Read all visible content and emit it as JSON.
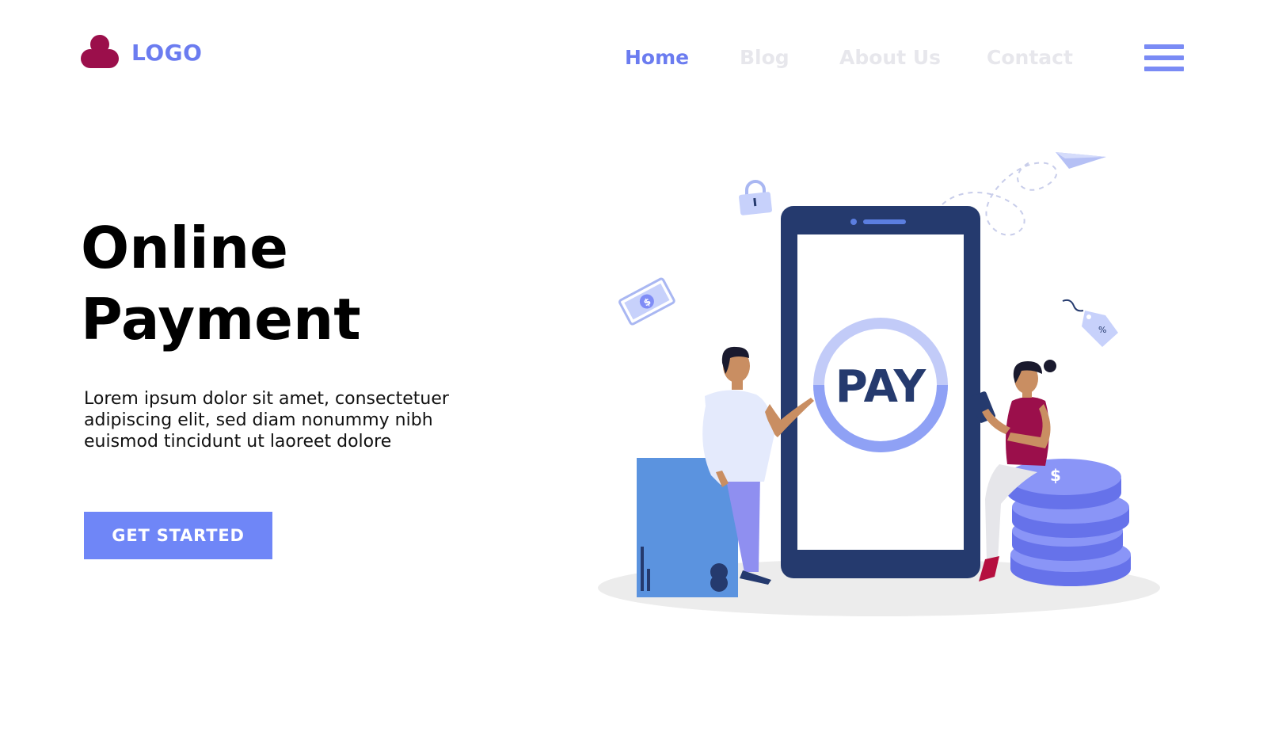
{
  "header": {
    "logo_text": "LOGO",
    "nav": [
      {
        "label": "Home",
        "active": true
      },
      {
        "label": "Blog",
        "active": false
      },
      {
        "label": "About Us",
        "active": false
      },
      {
        "label": "Contact",
        "active": false
      }
    ],
    "menu_icon": "hamburger-menu-icon"
  },
  "hero": {
    "title_line1": "Online",
    "title_line2": "Payment",
    "body": "Lorem ipsum dolor sit amet, consectetuer adipiscing elit, sed diam nonummy nibh euismod tincidunt ut laoreet dolore",
    "cta_label": "GET STARTED"
  },
  "illustration": {
    "pay_label": "PAY",
    "dollar_symbol": "$",
    "percent_symbol": "%",
    "icons": [
      "padlock-icon",
      "banknote-icon",
      "paper-plane-icon",
      "price-tag-icon",
      "credit-card-icon",
      "smartphone-icon",
      "coin-stack-icon"
    ]
  },
  "colors": {
    "accent": "#6b7cf0",
    "button": "#6f86f7",
    "logo_mark": "#9b0f4b",
    "phone_frame": "#253a6e",
    "nav_inactive": "#e7e7ec",
    "card": "#5b93df",
    "coins": "#7f8cf6"
  }
}
